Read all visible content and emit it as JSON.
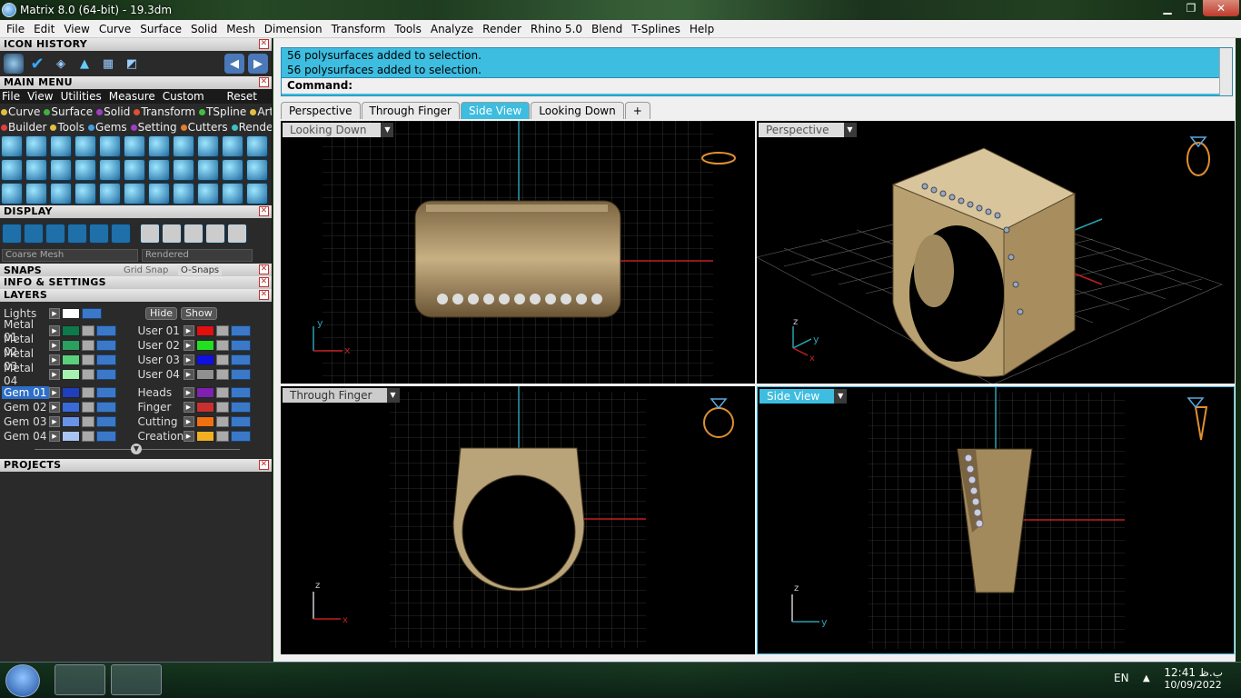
{
  "window": {
    "title": "Matrix 8.0 (64-bit) - 19.3dm",
    "minimize": "▁",
    "maximize": "❐",
    "close": "✕"
  },
  "menubar": [
    "File",
    "Edit",
    "View",
    "Curve",
    "Surface",
    "Solid",
    "Mesh",
    "Dimension",
    "Transform",
    "Tools",
    "Analyze",
    "Render",
    "Rhino 5.0",
    "Blend",
    "T-Splines",
    "Help"
  ],
  "left": {
    "icon_history": "ICON HISTORY",
    "main_menu": "MAIN MENU",
    "main_menu_items": [
      "File",
      "View",
      "Utilities",
      "Measure",
      "Custom"
    ],
    "reset": "Reset",
    "sub1": [
      {
        "label": "Curve",
        "color": "#e0c040"
      },
      {
        "label": "Surface",
        "color": "#40b040"
      },
      {
        "label": "Solid",
        "color": "#a040c0"
      },
      {
        "label": "Transform",
        "color": "#e05030"
      },
      {
        "label": "TSpline",
        "color": "#40c040"
      },
      {
        "label": "Art",
        "color": "#e0c040"
      }
    ],
    "sub2": [
      {
        "label": "Builder",
        "color": "#e04040"
      },
      {
        "label": "Tools",
        "color": "#e0c040"
      },
      {
        "label": "Gems",
        "color": "#40a0e0"
      },
      {
        "label": "Setting",
        "color": "#a040c0"
      },
      {
        "label": "Cutters",
        "color": "#e08030"
      },
      {
        "label": "Render",
        "color": "#40c0c0"
      }
    ],
    "display": "DISPLAY",
    "mesh_mode": "Coarse Mesh",
    "render_mode": "Rendered",
    "snaps": "SNAPS",
    "grid_snap": "Grid Snap",
    "o_snaps": "O-Snaps",
    "info": "INFO & SETTINGS",
    "layers": "LAYERS",
    "lights": "Lights",
    "hide": "Hide",
    "show": "Show",
    "layers_left": [
      {
        "name": "Metal 01",
        "color": "#0c7a4a"
      },
      {
        "name": "Metal 02",
        "color": "#2aa060"
      },
      {
        "name": "Metal 03",
        "color": "#5ad07a"
      },
      {
        "name": "Metal 04",
        "color": "#a6f0b0"
      },
      {
        "name": "Gem 01",
        "color": "#1f3fbf"
      },
      {
        "name": "Gem 02",
        "color": "#3a6ad8"
      },
      {
        "name": "Gem 03",
        "color": "#6a92e8"
      },
      {
        "name": "Gem 04",
        "color": "#a9c4f2"
      }
    ],
    "layers_right": [
      {
        "name": "User 01",
        "color": "#e01010"
      },
      {
        "name": "User 02",
        "color": "#20e020"
      },
      {
        "name": "User 03",
        "color": "#1010e0"
      },
      {
        "name": "User 04",
        "color": "#909090"
      },
      {
        "name": "Heads",
        "color": "#8020b0"
      },
      {
        "name": "Finger",
        "color": "#c83030"
      },
      {
        "name": "Cutting",
        "color": "#f07010"
      },
      {
        "name": "Creation",
        "color": "#f0b020"
      }
    ],
    "projects": "PROJECTS"
  },
  "command": {
    "line1": "56 polysurfaces added to selection.",
    "line2": "56 polysurfaces added to selection.",
    "prompt": "Command:"
  },
  "tabs": [
    "Perspective",
    "Through Finger",
    "Side View",
    "Looking Down",
    "+"
  ],
  "active_tab": "Side View",
  "viewports": {
    "tl": "Looking Down",
    "tr": "Perspective",
    "bl": "Through Finger",
    "br": "Side View"
  },
  "axes": {
    "x": "x",
    "y": "y",
    "z": "z"
  },
  "taskbar": {
    "lang": "EN",
    "time": "12:41 ب.ظ",
    "date": "10/09/2022"
  }
}
